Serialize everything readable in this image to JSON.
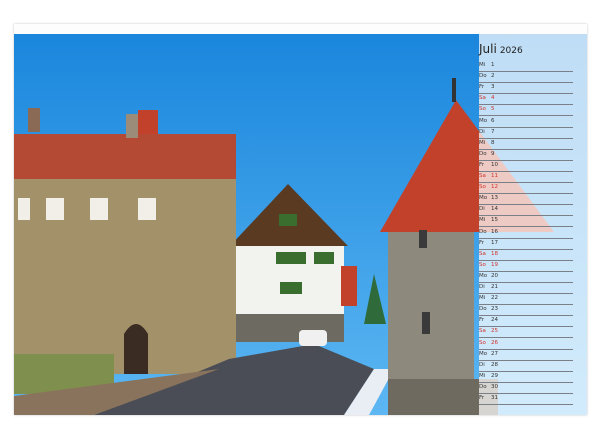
{
  "calendar": {
    "month": "Juli",
    "year": "2026",
    "days": [
      {
        "wd": "Mi",
        "n": "1",
        "red": false
      },
      {
        "wd": "Do",
        "n": "2",
        "red": false
      },
      {
        "wd": "Fr",
        "n": "3",
        "red": false
      },
      {
        "wd": "Sa",
        "n": "4",
        "red": true
      },
      {
        "wd": "So",
        "n": "5",
        "red": true
      },
      {
        "wd": "Mo",
        "n": "6",
        "red": false
      },
      {
        "wd": "Di",
        "n": "7",
        "red": false
      },
      {
        "wd": "Mi",
        "n": "8",
        "red": false
      },
      {
        "wd": "Do",
        "n": "9",
        "red": false
      },
      {
        "wd": "Fr",
        "n": "10",
        "red": false
      },
      {
        "wd": "Sa",
        "n": "11",
        "red": true
      },
      {
        "wd": "So",
        "n": "12",
        "red": true
      },
      {
        "wd": "Mo",
        "n": "13",
        "red": false
      },
      {
        "wd": "Di",
        "n": "14",
        "red": false
      },
      {
        "wd": "Mi",
        "n": "15",
        "red": false
      },
      {
        "wd": "Do",
        "n": "16",
        "red": false
      },
      {
        "wd": "Fr",
        "n": "17",
        "red": false
      },
      {
        "wd": "Sa",
        "n": "18",
        "red": true
      },
      {
        "wd": "So",
        "n": "19",
        "red": true
      },
      {
        "wd": "Mo",
        "n": "20",
        "red": false
      },
      {
        "wd": "Di",
        "n": "21",
        "red": false
      },
      {
        "wd": "Mi",
        "n": "22",
        "red": false
      },
      {
        "wd": "Do",
        "n": "23",
        "red": false
      },
      {
        "wd": "Fr",
        "n": "24",
        "red": false
      },
      {
        "wd": "Sa",
        "n": "25",
        "red": true
      },
      {
        "wd": "So",
        "n": "26",
        "red": true
      },
      {
        "wd": "Mo",
        "n": "27",
        "red": false
      },
      {
        "wd": "Di",
        "n": "28",
        "red": false
      },
      {
        "wd": "Mi",
        "n": "29",
        "red": false
      },
      {
        "wd": "Do",
        "n": "30",
        "red": false
      },
      {
        "wd": "Fr",
        "n": "31",
        "red": false
      }
    ]
  },
  "colors": {
    "sky": "#1f8fe0",
    "roof": "#c2412b",
    "accent_red": "#d0332b"
  }
}
